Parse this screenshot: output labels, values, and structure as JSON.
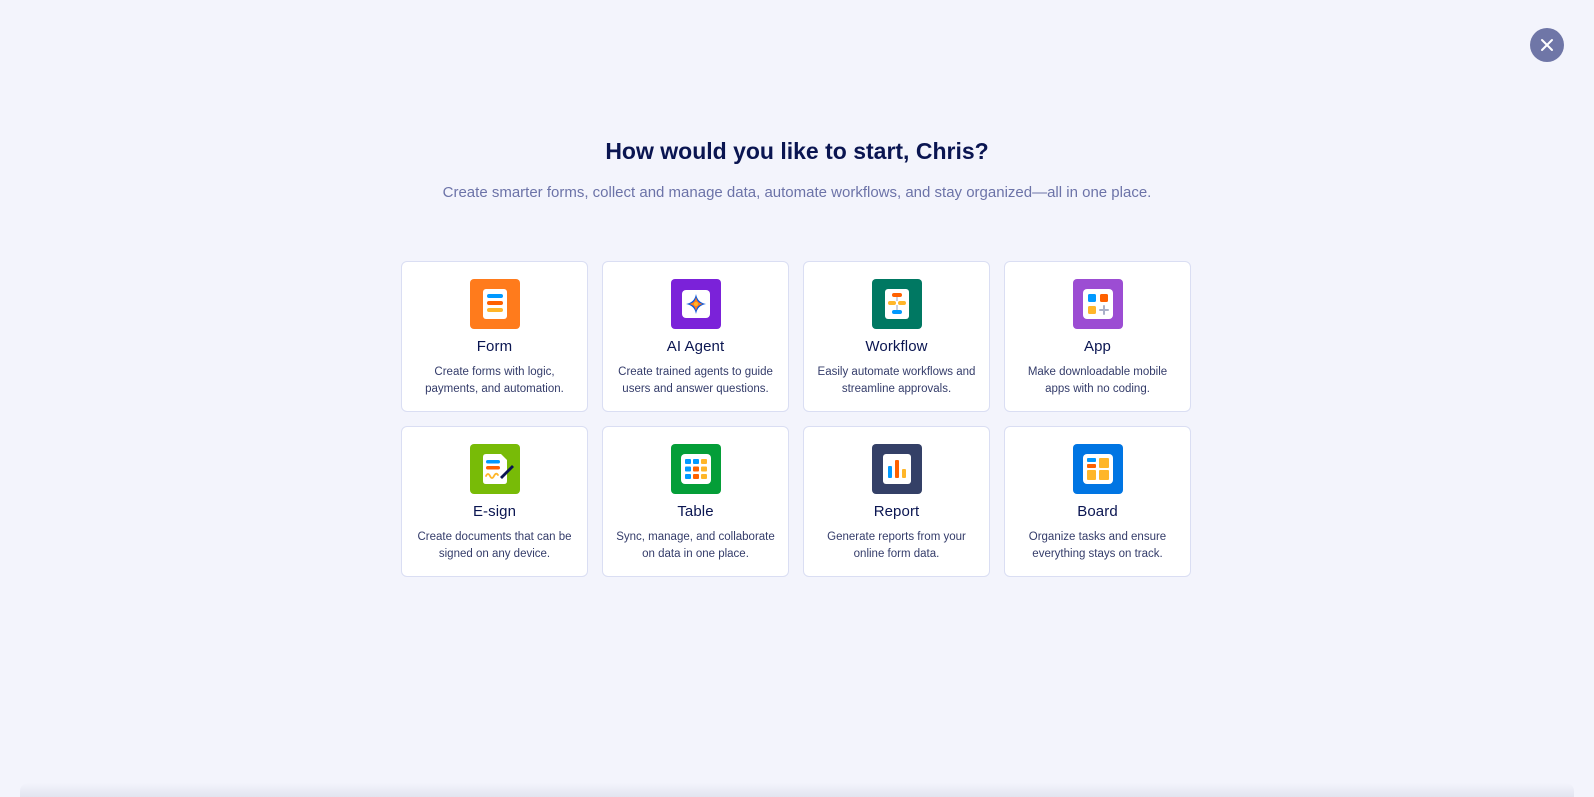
{
  "header": {
    "title": "How would you like to start, Chris?",
    "subtitle": "Create smarter forms, collect and manage data, automate workflows, and stay organized—all in one place."
  },
  "close": {
    "icon": "close-icon"
  },
  "colors": {
    "background": "#f3f4fc",
    "title": "#0a1551",
    "subtitle": "#6c73a8",
    "close_button": "#6f76a7"
  },
  "cards": [
    {
      "title": "Form",
      "desc_line1": "Create forms with logic,",
      "desc_line2": "payments, and automation.",
      "icon": "form-icon",
      "color": "#ff7b1c"
    },
    {
      "title": "AI Agent",
      "desc_line1": "Create trained agents to guide",
      "desc_line2": "users and answer questions.",
      "icon": "ai-agent-icon",
      "color": "#7b22d9"
    },
    {
      "title": "Workflow",
      "desc_line1": "Easily automate workflows and",
      "desc_line2": "streamline approvals.",
      "icon": "workflow-icon",
      "color": "#007862"
    },
    {
      "title": "App",
      "desc_line1": "Make downloadable mobile",
      "desc_line2": "apps with no coding.",
      "icon": "app-icon",
      "color": "#9c4dd3"
    },
    {
      "title": "E-sign",
      "desc_line1": "Create documents that can be",
      "desc_line2": "signed on any device.",
      "icon": "esign-icon",
      "color": "#78bb07"
    },
    {
      "title": "Table",
      "desc_line1": "Sync, manage, and collaborate",
      "desc_line2": "on data in one place.",
      "icon": "table-icon",
      "color": "#049e38"
    },
    {
      "title": "Report",
      "desc_line1": "Generate reports from your",
      "desc_line2": "online form data.",
      "icon": "report-icon",
      "color": "#344067"
    },
    {
      "title": "Board",
      "desc_line1": "Organize tasks and ensure",
      "desc_line2": "everything stays on track.",
      "icon": "board-icon",
      "color": "#0075e3"
    }
  ]
}
